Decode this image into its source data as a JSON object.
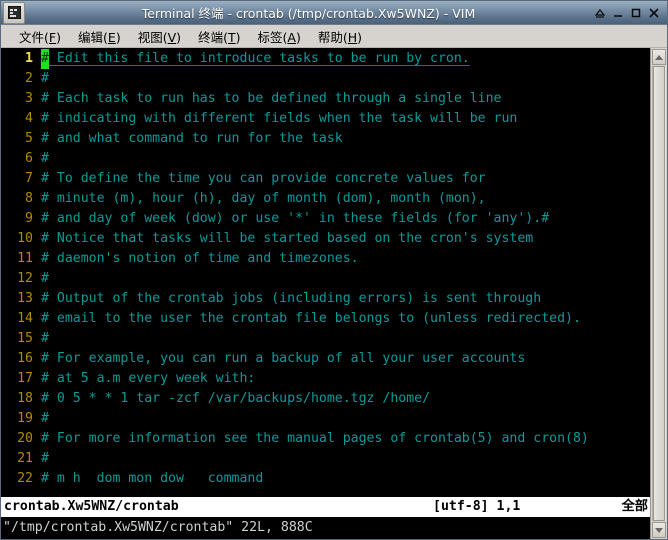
{
  "window": {
    "title": "Terminal 终端 - crontab (/tmp/crontab.Xw5WNZ) - VIM",
    "icon": "terminal-icon",
    "buttons": [
      {
        "name": "shade-button",
        "glyph": "shade"
      },
      {
        "name": "minimize-button",
        "glyph": "minimize"
      },
      {
        "name": "maximize-button",
        "glyph": "maximize"
      },
      {
        "name": "close-button",
        "glyph": "close"
      }
    ]
  },
  "menubar": {
    "items": [
      {
        "label": "文件",
        "mnemonic": "F"
      },
      {
        "label": "编辑",
        "mnemonic": "E"
      },
      {
        "label": "视图",
        "mnemonic": "V"
      },
      {
        "label": "终端",
        "mnemonic": "T"
      },
      {
        "label": "标签",
        "mnemonic": "A"
      },
      {
        "label": "帮助",
        "mnemonic": "H"
      }
    ]
  },
  "editor": {
    "cursor_char": "#",
    "lines": [
      {
        "num": "1",
        "text": " Edit this file to introduce tasks to be run by cron.",
        "cursor": true
      },
      {
        "num": "2",
        "text": "#"
      },
      {
        "num": "3",
        "text": "# Each task to run has to be defined through a single line"
      },
      {
        "num": "4",
        "text": "# indicating with different fields when the task will be run"
      },
      {
        "num": "5",
        "text": "# and what command to run for the task"
      },
      {
        "num": "6",
        "text": "#"
      },
      {
        "num": "7",
        "text": "# To define the time you can provide concrete values for"
      },
      {
        "num": "8",
        "text": "# minute (m), hour (h), day of month (dom), month (mon),"
      },
      {
        "num": "9",
        "text": "# and day of week (dow) or use '*' in these fields (for 'any').#"
      },
      {
        "num": "10",
        "text": "# Notice that tasks will be started based on the cron's system"
      },
      {
        "num": "11",
        "text": "# daemon's notion of time and timezones."
      },
      {
        "num": "12",
        "text": "#"
      },
      {
        "num": "13",
        "text": "# Output of the crontab jobs (including errors) is sent through"
      },
      {
        "num": "14",
        "text": "# email to the user the crontab file belongs to (unless redirected)."
      },
      {
        "num": "15",
        "text": "#"
      },
      {
        "num": "16",
        "text": "# For example, you can run a backup of all your user accounts"
      },
      {
        "num": "17",
        "text": "# at 5 a.m every week with:"
      },
      {
        "num": "18",
        "text": "# 0 5 * * 1 tar -zcf /var/backups/home.tgz /home/"
      },
      {
        "num": "19",
        "text": "#"
      },
      {
        "num": "20",
        "text": "# For more information see the manual pages of crontab(5) and cron(8)"
      },
      {
        "num": "21",
        "text": "#"
      },
      {
        "num": "22",
        "text": "# m h  dom mon dow   command"
      }
    ]
  },
  "statusline": {
    "file": "crontab.Xw5WNZ/crontab",
    "encoding_position": "[utf-8] 1,1",
    "scroll_position": "全部"
  },
  "commandline": {
    "message": "\"/tmp/crontab.Xw5WNZ/crontab\" 22L, 888C"
  },
  "scrollbar": {
    "up_arrow": "scroll-up-arrow",
    "down_arrow": "scroll-down-arrow"
  },
  "colors": {
    "terminal_bg": "#000000",
    "comment_text": "#0b9a9a",
    "line_number": "#b58900",
    "cursor_line_number": "#f2e14c",
    "cursor_block": "#1fe01f",
    "titlebar_top": "#9cb0c4",
    "titlebar_bottom": "#4a6177",
    "chrome_bg": "#d6d3ce"
  }
}
